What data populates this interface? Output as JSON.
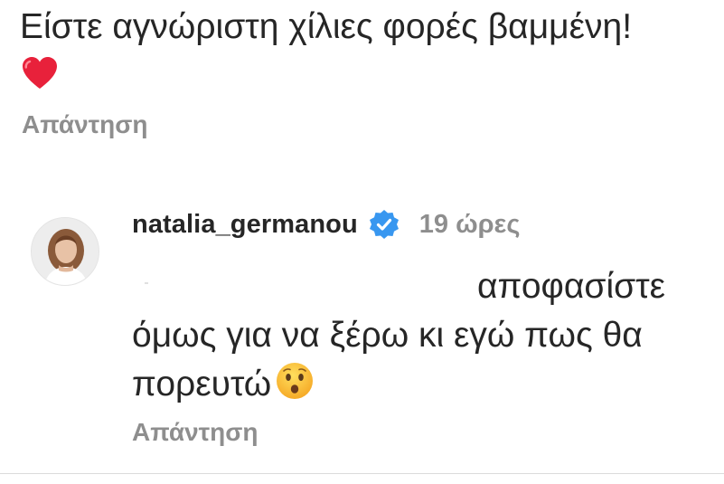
{
  "parent_comment": {
    "text": "Είστε αγνώριστη χίλιες φορές βαμμένη!",
    "emoji_icon": "red-heart",
    "reply_label": "Απάντηση"
  },
  "reply_comment": {
    "username": "natalia_germanou",
    "verified_icon": "verified-badge",
    "verified_color": "#3897f0",
    "time": "19 ώρες",
    "text_line1": "αποφασίστε",
    "text_rest": "όμως για να ξέρω κι εγώ πως θα πορευτώ",
    "emoji_icon": "hushed-face",
    "reply_label": "Απάντηση"
  },
  "colors": {
    "text": "#262626",
    "muted": "#8e8e8e",
    "divider": "#dbdbdb"
  }
}
